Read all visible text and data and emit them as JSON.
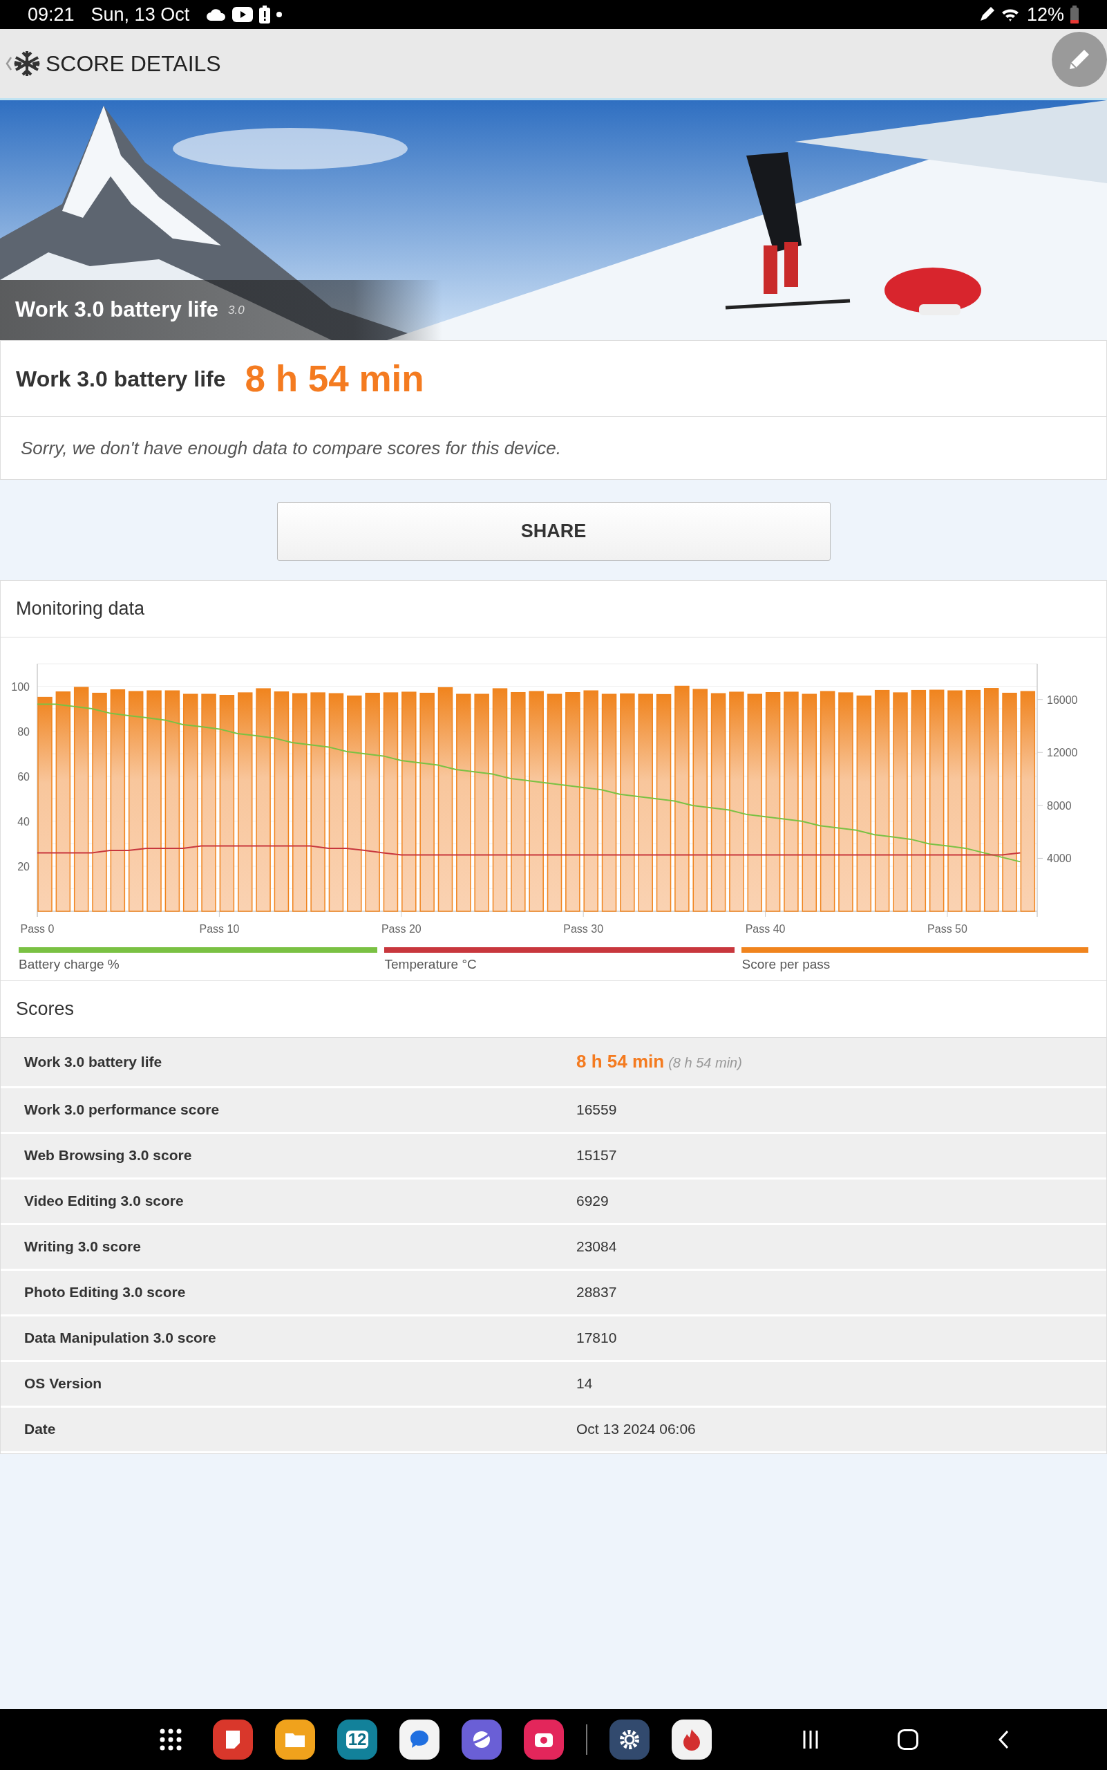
{
  "status_bar": {
    "time": "09:21",
    "date": "Sun, 13 Oct",
    "battery": "12%"
  },
  "header": {
    "title": "SCORE DETAILS"
  },
  "hero": {
    "kind": "picture",
    "title": "Work 3.0 battery life",
    "version": "3.0"
  },
  "result": {
    "label": "Work 3.0 battery life",
    "value": "8 h 54 min",
    "note": "Sorry, we don't have enough data to compare scores for this device."
  },
  "share_button": "SHARE",
  "monitoring": {
    "title": "Monitoring data",
    "chart_data": {
      "type": "bar",
      "categories": [
        "Pass 0",
        null,
        null,
        null,
        null,
        null,
        null,
        null,
        null,
        null,
        "Pass 10",
        null,
        null,
        null,
        null,
        null,
        null,
        null,
        null,
        null,
        "Pass 20",
        null,
        null,
        null,
        null,
        null,
        null,
        null,
        null,
        null,
        "Pass 30",
        null,
        null,
        null,
        null,
        null,
        null,
        null,
        null,
        null,
        "Pass 40",
        null,
        null,
        null,
        null,
        null,
        null,
        null,
        null,
        null,
        "Pass 50",
        null,
        null,
        null,
        null
      ],
      "series": [
        {
          "name": "Battery charge %",
          "color": "#7ac143",
          "type": "line",
          "values": [
            92,
            92,
            91,
            90,
            88,
            87,
            86,
            85,
            83,
            82,
            81,
            79,
            78,
            77,
            75,
            74,
            73,
            71,
            70,
            69,
            67,
            66,
            65,
            63,
            62,
            61,
            59,
            58,
            57,
            56,
            55,
            54,
            52,
            51,
            50,
            49,
            47,
            46,
            45,
            43,
            42,
            41,
            40,
            38,
            37,
            36,
            34,
            33,
            32,
            30,
            29,
            28,
            26,
            24,
            22
          ]
        },
        {
          "name": "Temperature °C",
          "color": "#c8373d",
          "type": "line",
          "values": [
            26,
            26,
            26,
            26,
            27,
            27,
            28,
            28,
            28,
            29,
            29,
            29,
            29,
            29,
            29,
            29,
            28,
            28,
            27,
            26,
            25,
            25,
            25,
            25,
            25,
            25,
            25,
            25,
            25,
            25,
            25,
            25,
            25,
            25,
            25,
            25,
            25,
            25,
            25,
            25,
            25,
            25,
            25,
            25,
            25,
            25,
            25,
            25,
            25,
            25,
            25,
            25,
            25,
            25,
            26
          ]
        },
        {
          "name": "Score per pass",
          "color": "#f0841e",
          "type": "bar",
          "axis": "y2",
          "values": [
            16160,
            16570,
            16910,
            16470,
            16730,
            16600,
            16650,
            16650,
            16390,
            16390,
            16310,
            16500,
            16810,
            16570,
            16440,
            16500,
            16440,
            16260,
            16470,
            16500,
            16550,
            16470,
            16890,
            16390,
            16390,
            16810,
            16520,
            16600,
            16390,
            16520,
            16650,
            16390,
            16420,
            16390,
            16370,
            17000,
            16760,
            16440,
            16550,
            16390,
            16520,
            16550,
            16390,
            16600,
            16500,
            16260,
            16680,
            16500,
            16680,
            16700,
            16650,
            16680,
            16830,
            16470,
            16600
          ]
        }
      ],
      "grid": true,
      "ylim": [
        0,
        110
      ],
      "yticks": [
        20,
        40,
        60,
        80,
        100
      ],
      "y2lim": [
        0,
        18700
      ],
      "y2ticks": [
        4000,
        8000,
        12000,
        16000
      ]
    }
  },
  "scores": {
    "title": "Scores",
    "rows": [
      {
        "kind": "primary",
        "label": "Work 3.0 battery life",
        "value": "8 h 54 min",
        "note": "(8 h 54 min)"
      },
      {
        "kind": "plain",
        "label": "Work 3.0 performance score",
        "value": "16559"
      },
      {
        "kind": "plain",
        "label": "Web Browsing 3.0 score",
        "value": "15157"
      },
      {
        "kind": "plain",
        "label": "Video Editing 3.0 score",
        "value": "6929"
      },
      {
        "kind": "plain",
        "label": "Writing 3.0 score",
        "value": "23084"
      },
      {
        "kind": "plain",
        "label": "Photo Editing 3.0 score",
        "value": "28837"
      },
      {
        "kind": "plain",
        "label": "Data Manipulation 3.0 score",
        "value": "17810"
      },
      {
        "kind": "plain",
        "label": "OS Version",
        "value": "14"
      },
      {
        "kind": "plain",
        "label": "Date",
        "value": "Oct 13 2024 06:06"
      }
    ]
  },
  "dock": {
    "calendar_day": "12"
  }
}
